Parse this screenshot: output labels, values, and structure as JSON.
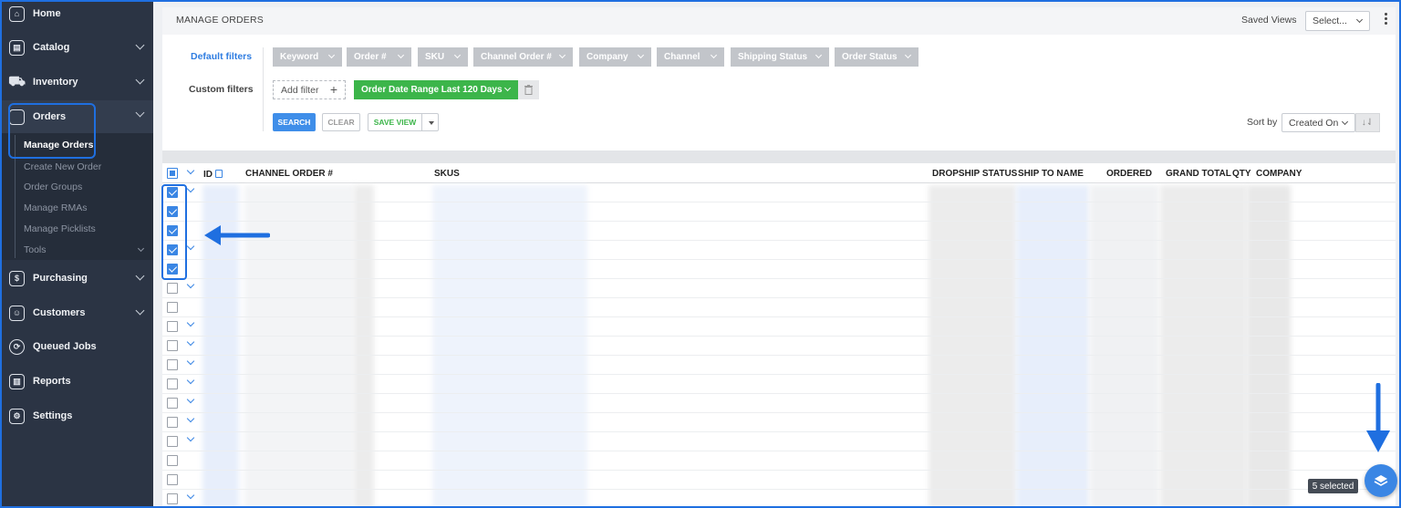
{
  "sidebar": {
    "items": [
      {
        "label": "Home",
        "icon": "home-icon"
      },
      {
        "label": "Catalog",
        "icon": "catalog-icon"
      },
      {
        "label": "Inventory",
        "icon": "inventory-icon"
      },
      {
        "label": "Orders",
        "icon": "bag-icon"
      },
      {
        "label": "Purchasing",
        "icon": "dollar-icon"
      },
      {
        "label": "Customers",
        "icon": "customers-icon"
      },
      {
        "label": "Queued Jobs",
        "icon": "sync-icon"
      },
      {
        "label": "Reports",
        "icon": "reports-icon"
      },
      {
        "label": "Settings",
        "icon": "settings-icon"
      }
    ],
    "orders_sub": [
      "Manage Orders",
      "Create New Order",
      "Order Groups",
      "Manage RMAs",
      "Manage Picklists",
      "Tools"
    ]
  },
  "header": {
    "title": "MANAGE ORDERS",
    "saved_views_label": "Saved Views",
    "saved_views_value": "Select..."
  },
  "filters": {
    "default_label": "Default filters",
    "custom_label": "Custom filters",
    "chips": [
      "Keyword",
      "Order #",
      "SKU",
      "Channel Order #",
      "Company",
      "Channel",
      "Shipping Status",
      "Order Status"
    ],
    "add_filter": "Add filter",
    "add_plus": "+",
    "active_custom": "Order Date Range Last 120 Days"
  },
  "actions": {
    "search": "SEARCH",
    "clear": "CLEAR",
    "save_view": "SAVE VIEW",
    "sort_label": "Sort by",
    "sort_value": "Created On",
    "sort_dir": "↓⇃"
  },
  "table": {
    "columns": {
      "id": "ID",
      "channel_order": "CHANNEL ORDER #",
      "skus": "SKUS",
      "dropship": "DROPSHIP STATUS",
      "ship_to": "SHIP TO NAME",
      "ordered": "ORDERED",
      "grand_total": "GRAND TOTAL",
      "qty": "QTY",
      "company": "COMPANY"
    }
  },
  "selection": {
    "badge": "5 selected",
    "count": 5
  },
  "colors": {
    "accent": "#3a86e4",
    "sidebar": "#2b3444",
    "highlight": "#1f6fe0",
    "green": "#3cb54a"
  }
}
